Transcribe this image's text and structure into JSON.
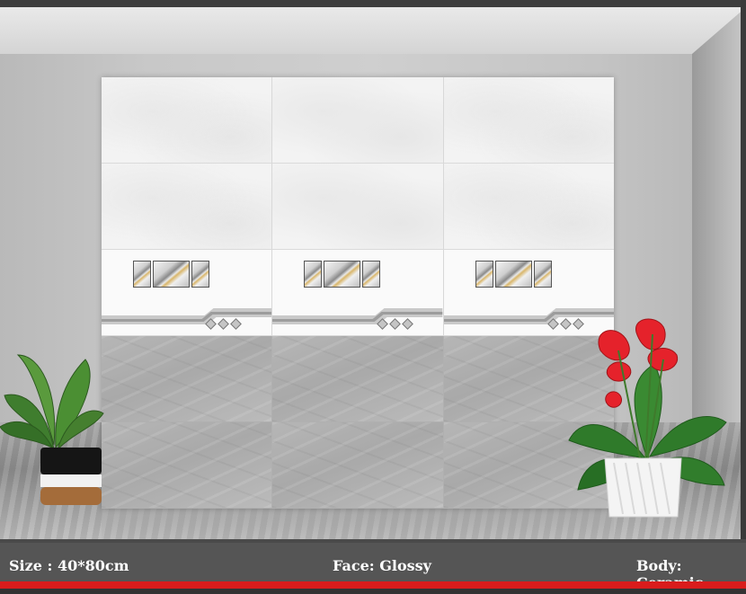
{
  "tile_layout": {
    "columns": 3
  },
  "specs": {
    "size": "Size : 40*80cm",
    "face": "Face: Glossy",
    "body": "Body: Ceramic"
  },
  "colors": {
    "accent_stripe": "#d91c1c",
    "info_bar": "#555555",
    "light_tile": "#f3f3f3",
    "dark_tile": "#afafaf"
  },
  "plants": [
    "potted-monstera",
    "anthurium-plant"
  ]
}
